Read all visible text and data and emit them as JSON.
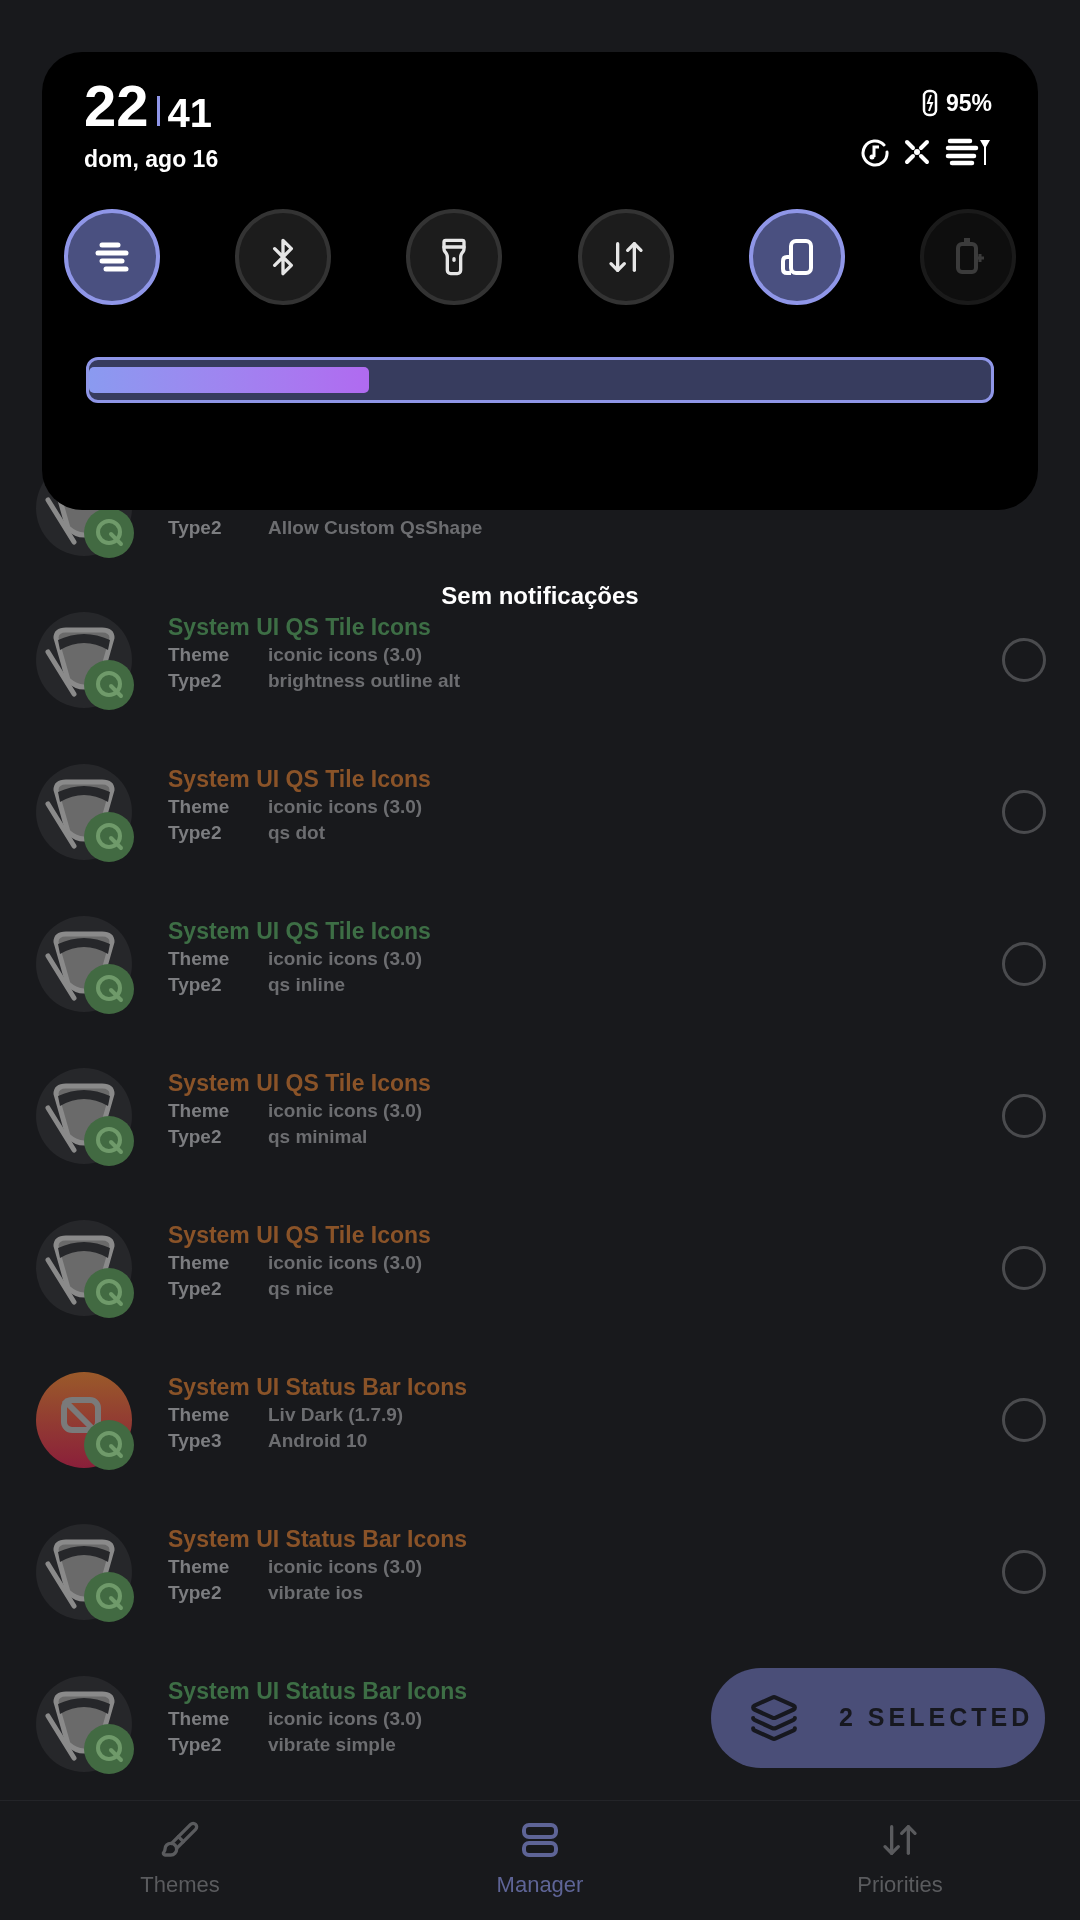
{
  "header": {
    "hours": "22",
    "minutes": "41",
    "date": "dom, ago 16",
    "battery": "95%"
  },
  "tiles": [
    {
      "on": true,
      "disabled": false
    },
    {
      "on": false,
      "disabled": false
    },
    {
      "on": false,
      "disabled": false
    },
    {
      "on": false,
      "disabled": false
    },
    {
      "on": true,
      "disabled": false
    },
    {
      "on": false,
      "disabled": true
    }
  ],
  "brightness": {
    "level": 0.31
  },
  "empty_message": "Sem notificações",
  "partial_item": {
    "type_label": "Type2",
    "type_value": "Allow Custom QsShape"
  },
  "items": [
    {
      "title": "System UI QS Tile Icons",
      "color": "#3d6e45",
      "theme_label": "Theme",
      "theme_value": "iconic icons (3.0)",
      "type_label": "Type2",
      "type_value": "brightness outline alt",
      "kind": "iconic",
      "selected": false
    },
    {
      "title": "System UI QS Tile Icons",
      "color": "#8a5328",
      "theme_label": "Theme",
      "theme_value": "iconic icons (3.0)",
      "type_label": "Type2",
      "type_value": "qs dot",
      "kind": "iconic",
      "selected": false
    },
    {
      "title": "System UI QS Tile Icons",
      "color": "#3d6e45",
      "theme_label": "Theme",
      "theme_value": "iconic icons (3.0)",
      "type_label": "Type2",
      "type_value": "qs inline",
      "kind": "iconic",
      "selected": false
    },
    {
      "title": "System UI QS Tile Icons",
      "color": "#8a5328",
      "theme_label": "Theme",
      "theme_value": "iconic icons (3.0)",
      "type_label": "Type2",
      "type_value": "qs minimal",
      "kind": "iconic",
      "selected": false
    },
    {
      "title": "System UI QS Tile Icons",
      "color": "#8a5328",
      "theme_label": "Theme",
      "theme_value": "iconic icons (3.0)",
      "type_label": "Type2",
      "type_value": "qs nice",
      "kind": "iconic",
      "selected": false
    },
    {
      "title": "System UI Status Bar Icons",
      "color": "#8a5328",
      "theme_label": "Theme",
      "theme_value": "Liv Dark (1.7.9)",
      "type_label": "Type3",
      "type_value": "Android 10",
      "kind": "liv",
      "selected": false
    },
    {
      "title": "System UI Status Bar Icons",
      "color": "#8a5328",
      "theme_label": "Theme",
      "theme_value": "iconic icons (3.0)",
      "type_label": "Type2",
      "type_value": "vibrate ios",
      "kind": "iconic",
      "selected": false
    },
    {
      "title": "System UI Status Bar Icons",
      "color": "#3d6e45",
      "theme_label": "Theme",
      "theme_value": "iconic icons (3.0)",
      "type_label": "Type2",
      "type_value": "vibrate simple",
      "kind": "iconic"
    }
  ],
  "fab": {
    "label": "2 SELECTED"
  },
  "nav": [
    {
      "label": "Themes",
      "selected": false
    },
    {
      "label": "Manager",
      "selected": true
    },
    {
      "label": "Priorities",
      "selected": false
    }
  ]
}
